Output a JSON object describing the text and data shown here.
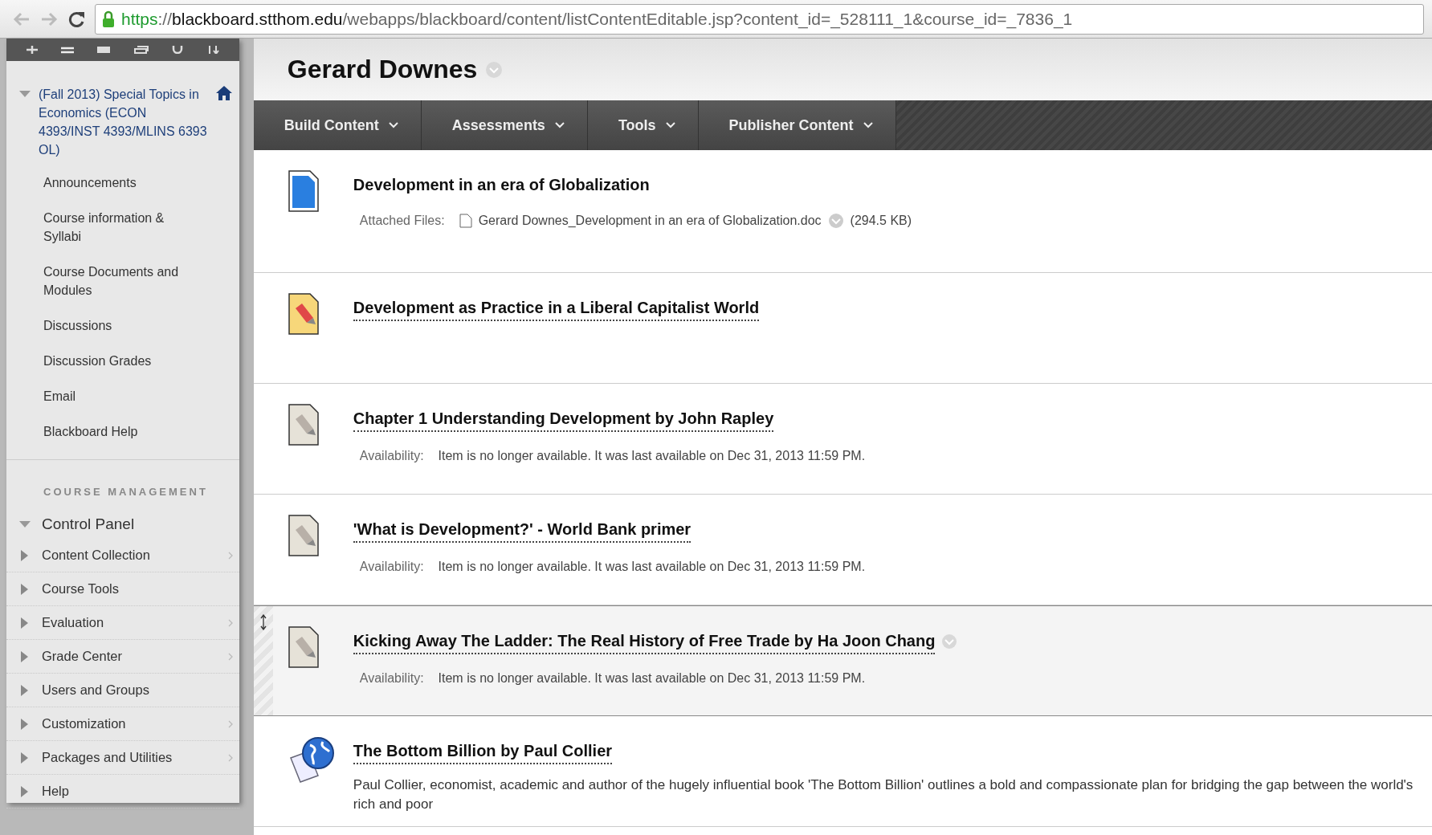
{
  "browser": {
    "url_scheme": "https",
    "url_sep": "://",
    "url_host": "blackboard.stthom.edu",
    "url_path": "/webapps/blackboard/content/listContentEditable.jsp?content_id=_528111_1&course_id=_7836_1"
  },
  "sidebar": {
    "course_title": "(Fall 2013) Special Topics in Economics (ECON 4393/INST 4393/MLINS 6393 OL)",
    "expanded": true,
    "items": [
      {
        "label": "Announcements"
      },
      {
        "label": "Course information & Syllabi"
      },
      {
        "label": "Course Documents and Modules"
      },
      {
        "label": "Discussions"
      },
      {
        "label": "Discussion Grades"
      },
      {
        "label": "Email"
      },
      {
        "label": "Blackboard Help"
      }
    ],
    "management_heading": "COURSE MANAGEMENT",
    "control_panel": {
      "label": "Control Panel",
      "expanded": true,
      "items": [
        {
          "label": "Content Collection",
          "expanded": false,
          "flyout": true
        },
        {
          "label": "Course Tools",
          "expanded": false,
          "flyout": false
        },
        {
          "label": "Evaluation",
          "expanded": false,
          "flyout": true
        },
        {
          "label": "Grade Center",
          "expanded": false,
          "flyout": true
        },
        {
          "label": "Users and Groups",
          "expanded": false,
          "flyout": false
        },
        {
          "label": "Customization",
          "expanded": false,
          "flyout": true
        },
        {
          "label": "Packages and Utilities",
          "expanded": false,
          "flyout": true
        },
        {
          "label": "Help",
          "expanded": false,
          "flyout": false
        }
      ]
    }
  },
  "page_title": "Gerard Downes",
  "action_bar": [
    {
      "label": "Build Content"
    },
    {
      "label": "Assessments"
    },
    {
      "label": "Tools"
    },
    {
      "label": "Publisher Content"
    }
  ],
  "content_items": [
    {
      "kind": "file",
      "title": "Development in an era of Globalization",
      "linked": false,
      "highlighted": false,
      "menu": false,
      "detail_label": "Attached Files:",
      "attachment": "Gerard Downes_Development in an era of Globalization.doc",
      "attachment_size": "(294.5 KB)"
    },
    {
      "kind": "item",
      "title": "Development as Practice in a Liberal Capitalist World",
      "linked": true,
      "highlighted": false,
      "menu": false,
      "available": true
    },
    {
      "kind": "item",
      "title": "Chapter 1 Understanding Development by John Rapley",
      "linked": true,
      "highlighted": false,
      "menu": false,
      "available": false,
      "detail_label": "Availability:",
      "detail": "Item is no longer available. It was last available on Dec 31, 2013 11:59 PM."
    },
    {
      "kind": "item",
      "title": "'What is Development?' - World Bank primer",
      "linked": true,
      "highlighted": false,
      "menu": false,
      "available": false,
      "detail_label": "Availability:",
      "detail": "Item is no longer available. It was last available on Dec 31, 2013 11:59 PM."
    },
    {
      "kind": "item",
      "title": "Kicking Away The Ladder: The Real History of Free Trade by Ha Joon Chang",
      "linked": true,
      "highlighted": true,
      "menu": true,
      "available": false,
      "detail_label": "Availability:",
      "detail": "Item is no longer available. It was last available on Dec 31, 2013 11:59 PM."
    },
    {
      "kind": "link",
      "title": "The Bottom Billion by Paul Collier",
      "linked": true,
      "highlighted": false,
      "menu": false,
      "description": "Paul Collier, economist, academic and author of the hugely influential book 'The Bottom Billion' outlines a bold and compassionate plan for bridging the gap between the world's rich and poor"
    }
  ]
}
